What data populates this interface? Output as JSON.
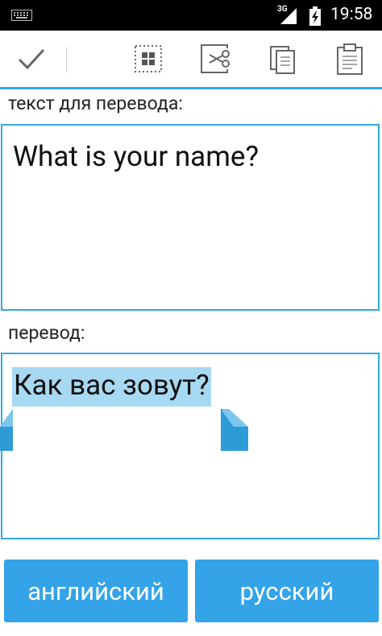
{
  "status_bar": {
    "network": "3G",
    "time": "19:58",
    "icons": [
      "keyboard-icon",
      "signal-icon",
      "battery-charging-icon"
    ]
  },
  "action_bar": {
    "items": [
      {
        "name": "done",
        "icon": "checkmark-icon"
      },
      {
        "name": "select-all",
        "icon": "select-all-icon"
      },
      {
        "name": "cut",
        "icon": "cut-icon"
      },
      {
        "name": "copy",
        "icon": "copy-icon"
      },
      {
        "name": "paste",
        "icon": "paste-icon"
      }
    ]
  },
  "source": {
    "label": "текст для перевода:",
    "text": "What is your name?"
  },
  "result": {
    "label": "перевод:",
    "text": "Как вас зовут?",
    "selected": true
  },
  "languages": {
    "from": "английский",
    "to": "русский"
  },
  "colors": {
    "accent": "#33a8e3",
    "button": "#35a3e8",
    "selection": "#a8d9f2",
    "status_bar": "#000000"
  }
}
